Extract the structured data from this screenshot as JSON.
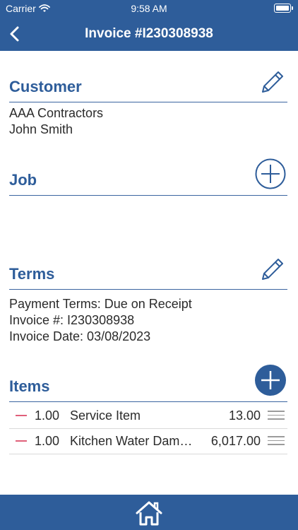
{
  "status_bar": {
    "carrier": "Carrier",
    "time": "9:58 AM"
  },
  "nav": {
    "title": "Invoice #I230308938"
  },
  "customer": {
    "title": "Customer",
    "company": "AAA Contractors",
    "contact": "John Smith"
  },
  "job": {
    "title": "Job"
  },
  "terms": {
    "title": "Terms",
    "payment_terms": "Payment Terms:  Due on Receipt",
    "invoice_number": "Invoice #:  I230308938",
    "invoice_date": "Invoice Date:  03/08/2023"
  },
  "items": {
    "title": "Items",
    "rows": [
      {
        "qty": "1.00",
        "description": "Service Item",
        "amount": "13.00"
      },
      {
        "qty": "1.00",
        "description": "Kitchen Water Dam…",
        "amount": "6,017.00"
      }
    ]
  },
  "colors": {
    "primary": "#2e5d9a",
    "remove": "#e0607a"
  },
  "icons": [
    "wifi-icon",
    "battery-icon",
    "back-chevron-icon",
    "edit-pencil-icon",
    "add-circle-icon",
    "remove-minus-icon",
    "drag-handle-icon",
    "home-icon"
  ]
}
